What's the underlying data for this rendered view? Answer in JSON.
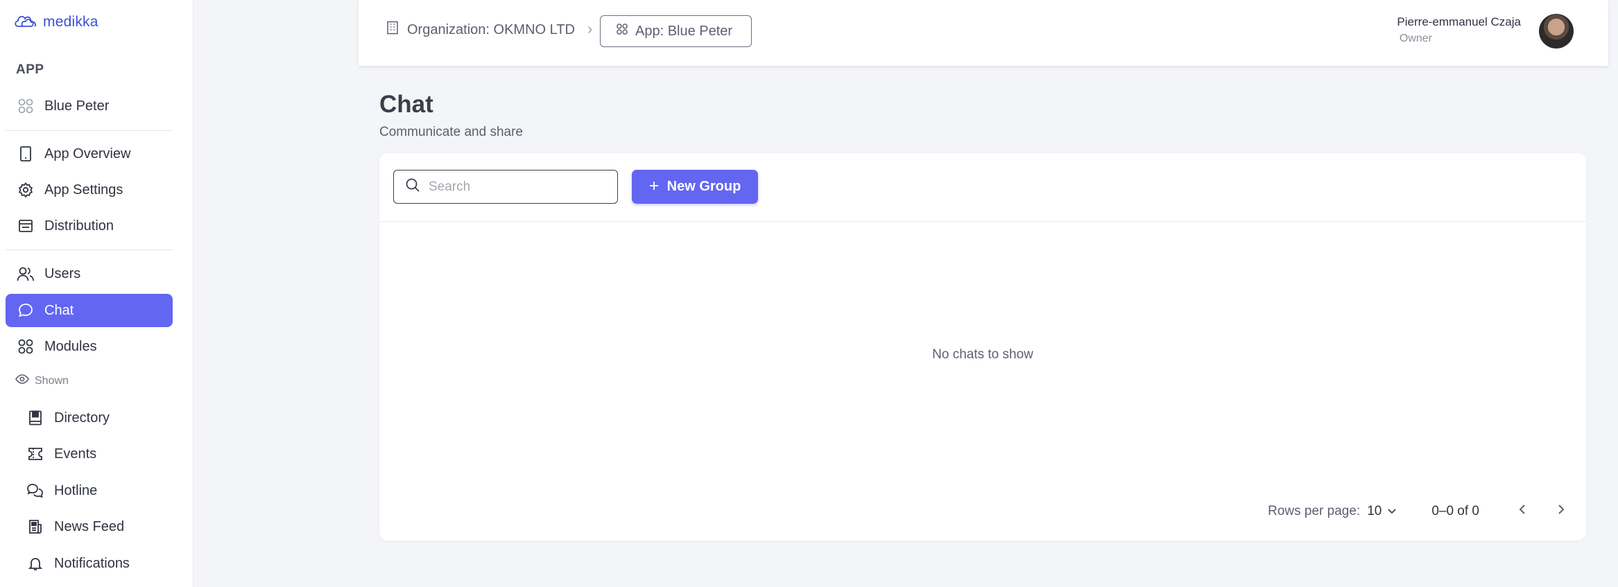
{
  "app": {
    "logo_text": "medikka",
    "brand_color": "#6366f1",
    "logo_color": "#3b4fd8"
  },
  "sidebar": {
    "section_label": "APP",
    "app_name": "Blue Peter",
    "items": [
      {
        "label": "App Overview",
        "icon": "tablet-icon"
      },
      {
        "label": "App Settings",
        "icon": "gear-icon"
      },
      {
        "label": "Distribution",
        "icon": "store-icon"
      },
      {
        "label": "Users",
        "icon": "users-icon"
      },
      {
        "label": "Chat",
        "icon": "chat-bubble-icon",
        "active": true
      },
      {
        "label": "Modules",
        "icon": "grid-icon"
      }
    ],
    "shown_label": "Shown",
    "modules": [
      {
        "label": "Directory",
        "icon": "book-icon"
      },
      {
        "label": "Events",
        "icon": "ticket-icon"
      },
      {
        "label": "Hotline",
        "icon": "chats-icon"
      },
      {
        "label": "News Feed",
        "icon": "newspaper-icon"
      },
      {
        "label": "Notifications",
        "icon": "bell-icon"
      }
    ]
  },
  "header": {
    "org_crumb": "Organization: OKMNO LTD",
    "app_crumb": "App: Blue Peter",
    "user_name": "Pierre-emmanuel Czaja",
    "user_role": "Owner"
  },
  "main": {
    "title": "Chat",
    "subtitle": "Communicate and share",
    "search_placeholder": "Search",
    "search_value": "",
    "new_group_label": "New Group",
    "empty_text": "No chats to show",
    "rows_per_page_label": "Rows per page:",
    "rows_per_page_value": "10",
    "range_text": "0–0 of 0"
  }
}
